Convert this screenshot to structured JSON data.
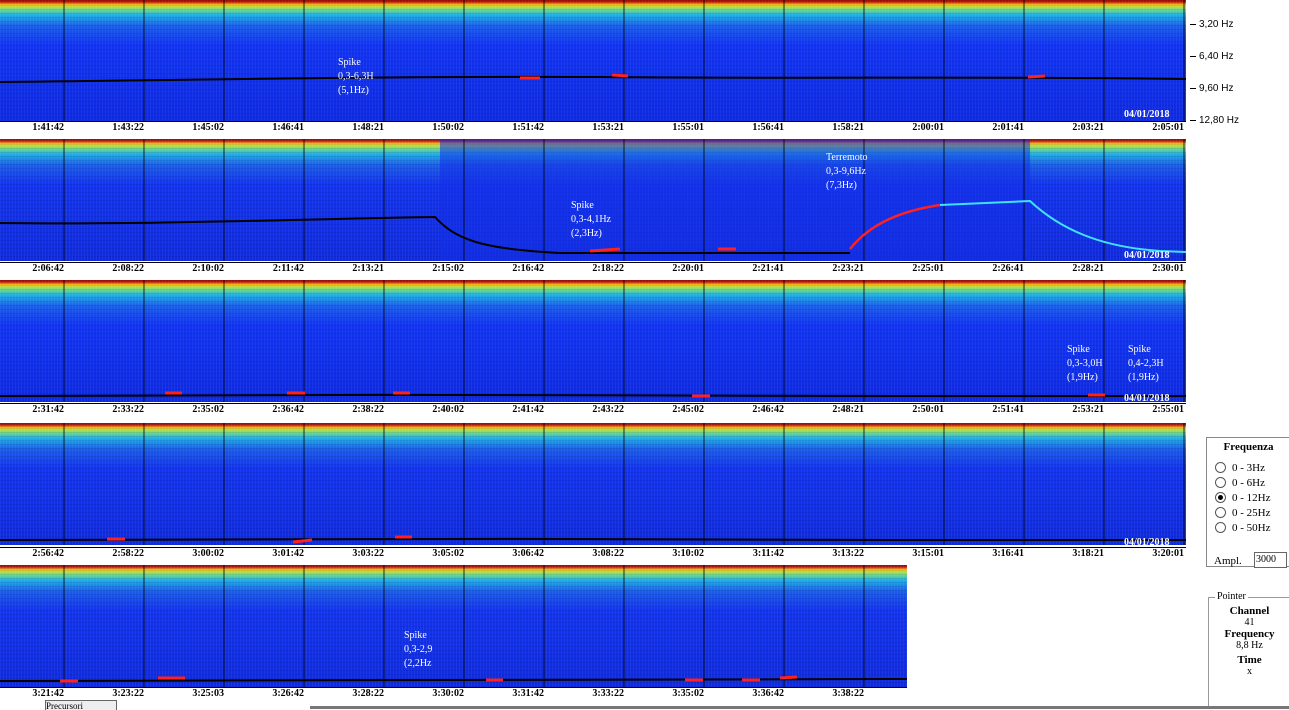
{
  "strips": [
    {
      "times": [
        "1:41:42",
        "1:43:22",
        "1:45:02",
        "1:46:41",
        "1:48:21",
        "1:50:02",
        "1:51:42",
        "1:53:21",
        "1:55:01",
        "1:56:41",
        "1:58:21",
        "2:00:01",
        "2:01:41",
        "2:03:21",
        "2:05:01"
      ],
      "date": "04/01/2018",
      "notes": [
        {
          "text": "Spike\n0,3-6,3H\n(5,1Hz)"
        }
      ]
    },
    {
      "times": [
        "2:06:42",
        "2:08:22",
        "2:10:02",
        "2:11:42",
        "2:13:21",
        "2:15:02",
        "2:16:42",
        "2:18:22",
        "2:20:01",
        "2:21:41",
        "2:23:21",
        "2:25:01",
        "2:26:41",
        "2:28:21",
        "2:30:01"
      ],
      "date": "04/01/2018",
      "notes": [
        {
          "text": "Spike\n0,3-4,1Hz\n(2,3Hz)"
        },
        {
          "text": "Terremoto\n0,3-9,6Hz\n(7,3Hz)"
        }
      ]
    },
    {
      "times": [
        "2:31:42",
        "2:33:22",
        "2:35:02",
        "2:36:42",
        "2:38:22",
        "2:40:02",
        "2:41:42",
        "2:43:22",
        "2:45:02",
        "2:46:42",
        "2:48:21",
        "2:50:01",
        "2:51:41",
        "2:53:21",
        "2:55:01"
      ],
      "date": "04/01/2018",
      "notes": [
        {
          "text": "Spike\n0,3-3,0H\n(1,9Hz)"
        },
        {
          "text": "Spike\n0,4-2,3H\n(1,9Hz)"
        }
      ]
    },
    {
      "times": [
        "2:56:42",
        "2:58:22",
        "3:00:02",
        "3:01:42",
        "3:03:22",
        "3:05:02",
        "3:06:42",
        "3:08:22",
        "3:10:02",
        "3:11:42",
        "3:13:22",
        "3:15:01",
        "3:16:41",
        "3:18:21",
        "3:20:01"
      ],
      "date": "04/01/2018",
      "notes": []
    },
    {
      "times": [
        "3:21:42",
        "3:23:22",
        "3:25:03",
        "3:26:42",
        "3:28:22",
        "3:30:02",
        "3:31:42",
        "3:33:22",
        "3:35:02",
        "3:36:42",
        "3:38:22"
      ],
      "date": "",
      "notes": [
        {
          "text": "Spike\n0,3-2,9\n(2,2Hz"
        }
      ]
    }
  ],
  "freq_axis": [
    "3,20 Hz",
    "6,40 Hz",
    "9,60 Hz",
    "12,80 Hz"
  ],
  "frequenza": {
    "title": "Frequenza",
    "options": [
      "0 - 3Hz",
      "0 - 6Hz",
      "0 - 12Hz",
      "0 - 25Hz",
      "0 - 50Hz"
    ],
    "selected": "0 - 12Hz"
  },
  "ampl": {
    "label": "Ampl.",
    "value": "3000"
  },
  "pointer": {
    "legend": "Pointer",
    "channel_label": "Channel",
    "channel_value": "41",
    "frequency_label": "Frequency",
    "frequency_value": "8,8 Hz",
    "time_label": "Time",
    "time_value": "x"
  },
  "bottom_tab": "Precursori",
  "colors": {
    "background_spectrum": "#1234f0",
    "trace": "#000000",
    "spike_marks": "#ff2020",
    "quake_trace": "#40e0ff"
  }
}
